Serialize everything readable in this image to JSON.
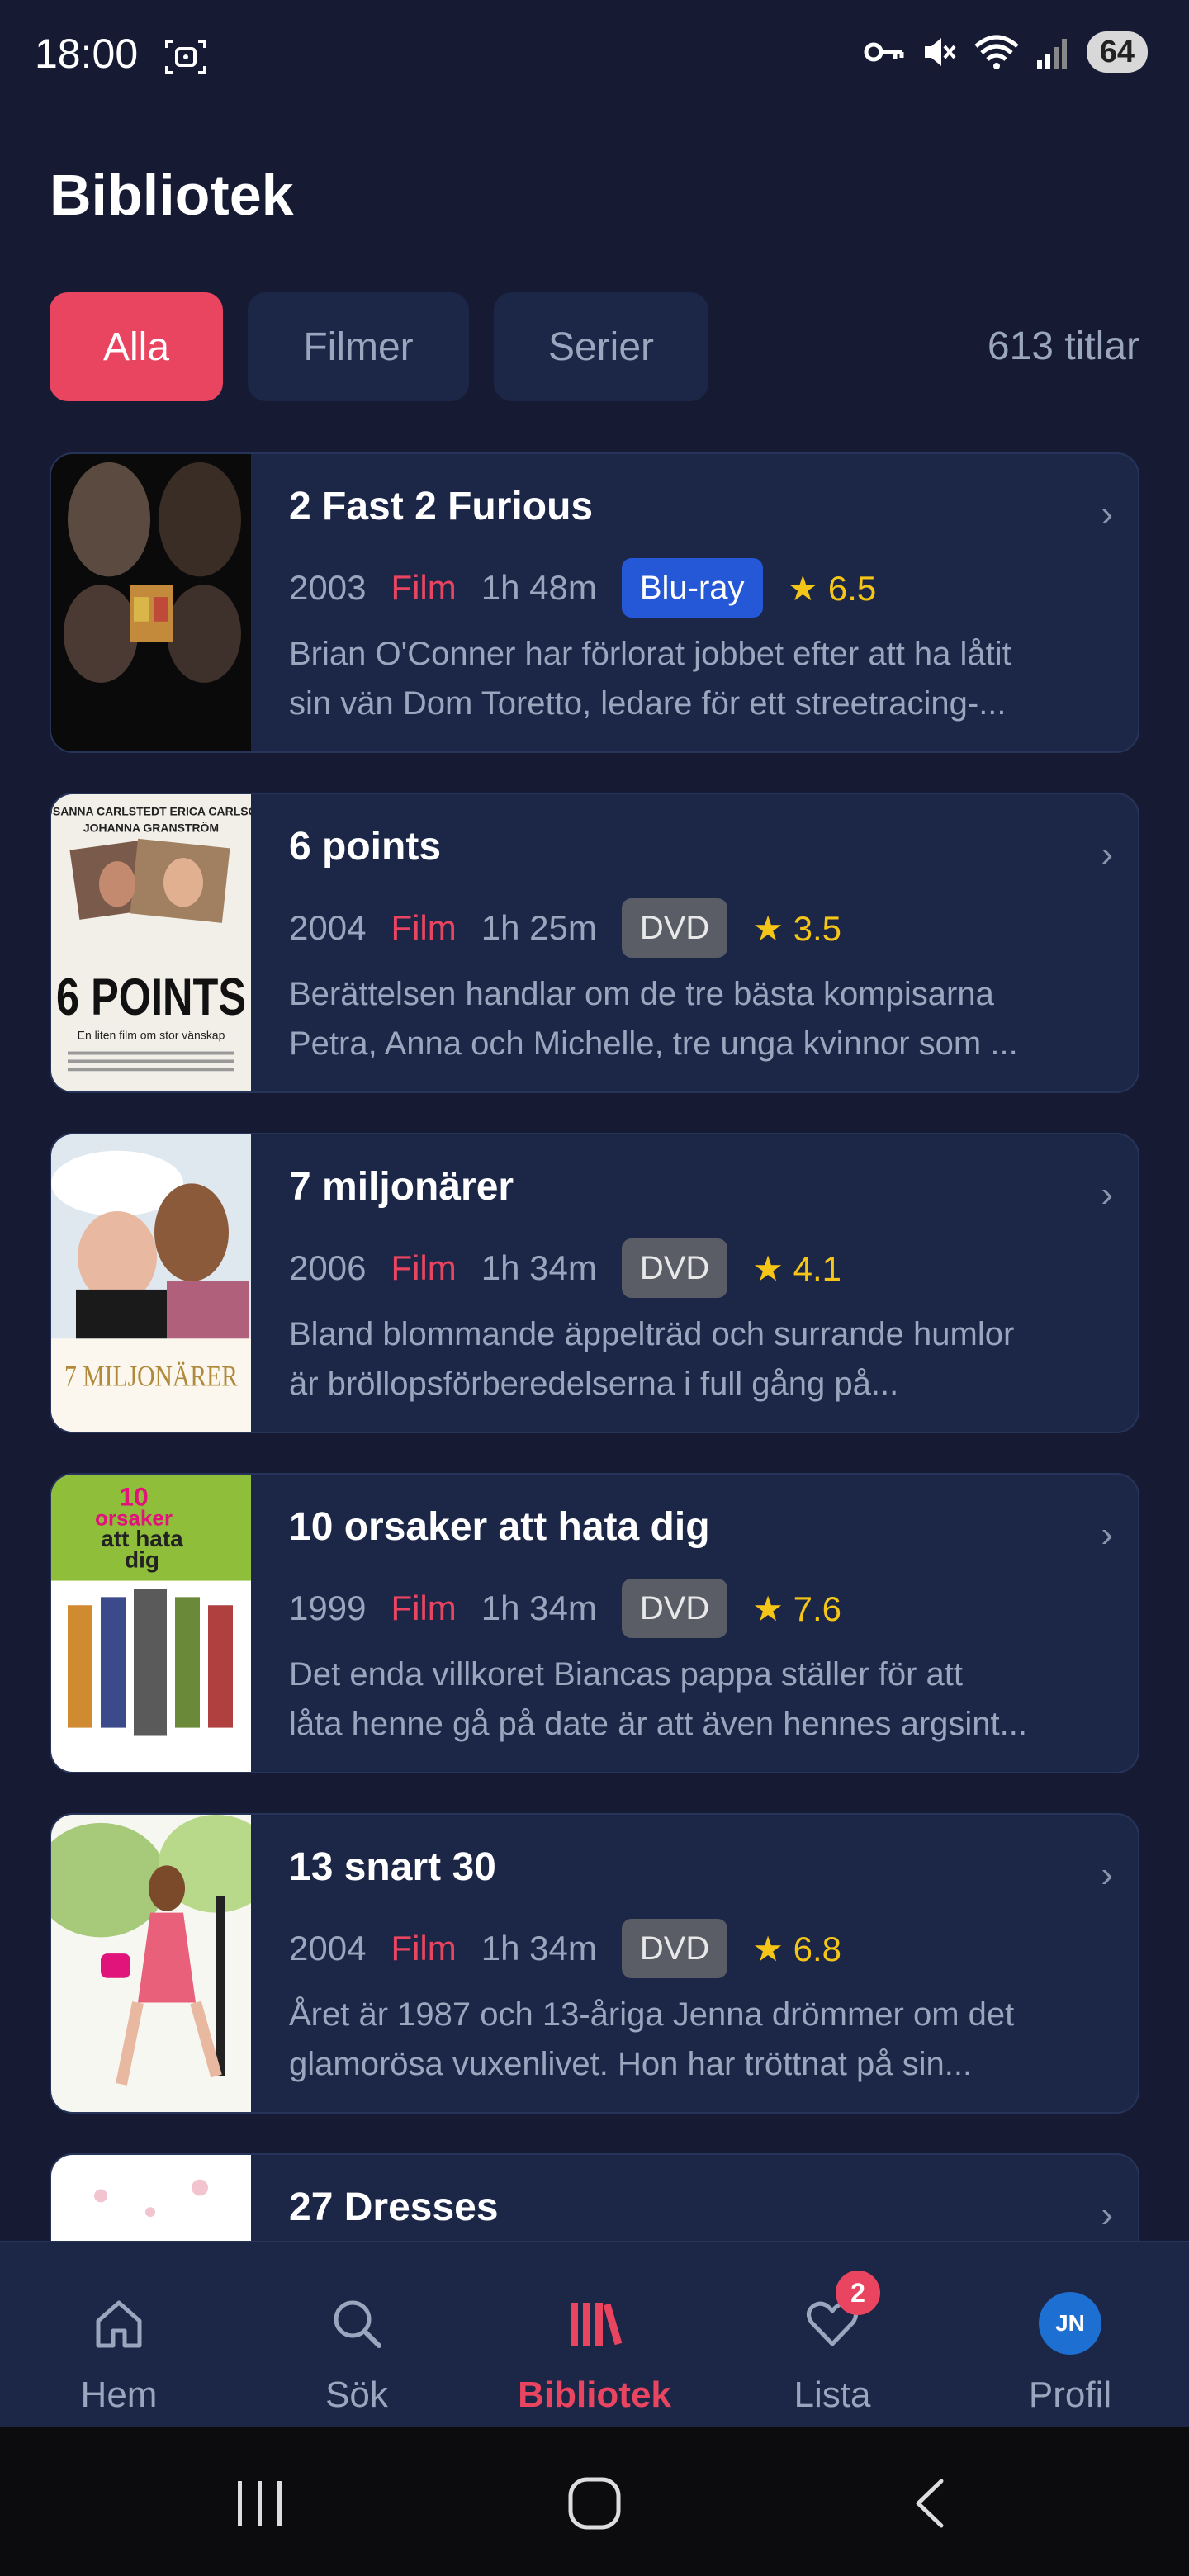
{
  "status_bar": {
    "time": "18:00",
    "battery": "64",
    "icons": [
      "screenshot-icon",
      "key-icon",
      "mute-icon",
      "wifi-icon",
      "signal-icon",
      "battery-icon"
    ]
  },
  "header": {
    "title": "Bibliotek"
  },
  "filters": {
    "chips": [
      "Alla",
      "Filmer",
      "Serier"
    ],
    "active": "Alla",
    "count": "613 titlar"
  },
  "colors": {
    "accent": "#e94560",
    "background": "#161b33",
    "card": "#1c2747",
    "bluray": "#2558d6",
    "dvd": "#5a5d66",
    "rating": "#f5c518"
  },
  "items": [
    {
      "title": "2 Fast 2 Furious",
      "year": "2003",
      "type": "Film",
      "length": "1h 48m",
      "format": "Blu-ray",
      "rating": "★ 6.5",
      "desc1": "Brian O'Conner har förlorat jobbet efter att ha låtit",
      "desc2": "sin vän Dom Toretto, ledare för ett streetracing-..."
    },
    {
      "title": "6 points",
      "year": "2004",
      "type": "Film",
      "length": "1h 25m",
      "format": "DVD",
      "rating": "★ 3.5",
      "desc1": "Berättelsen handlar om de tre bästa kompisarna",
      "desc2": "Petra, Anna och Michelle, tre unga kvinnor som ...",
      "poster_text": "6 POINTS",
      "poster_names": "SUSANNA CARLSTEDT   ERICA CARLSON",
      "poster_names2": "JOHANNA GRANSTRÖM",
      "poster_tagline": "En liten film om stor vänskap"
    },
    {
      "title": "7 miljonärer",
      "year": "2006",
      "type": "Film",
      "length": "1h 34m",
      "format": "DVD",
      "rating": "★ 4.1",
      "desc1": "Bland blommande äppelträd och surrande humlor",
      "desc2": "är bröllopsförberedelserna i full gång på...",
      "poster_text": "7 MILJONÄRER"
    },
    {
      "title": "10 orsaker att hata dig",
      "year": "1999",
      "type": "Film",
      "length": "1h 34m",
      "format": "DVD",
      "rating": "★ 7.6",
      "desc1": "Det enda villkoret Biancas pappa ställer för att",
      "desc2": "låta henne gå på date är att även hennes argsint...",
      "poster_l1": "10",
      "poster_l2": "orsaker",
      "poster_l3": "att hata",
      "poster_l4": "dig"
    },
    {
      "title": "13 snart 30",
      "year": "2004",
      "type": "Film",
      "length": "1h 34m",
      "format": "DVD",
      "rating": "★ 6.8",
      "desc1": "Året är 1987 och 13-åriga Jenna drömmer om det",
      "desc2": "glamorösa vuxenlivet. Hon har tröttnat på sin..."
    },
    {
      "title": "27 Dresses"
    }
  ],
  "bottom_nav": {
    "items": [
      "Hem",
      "Sök",
      "Bibliotek",
      "Lista",
      "Profil"
    ],
    "active": "Bibliotek",
    "list_badge": "2",
    "avatar_initials": "JN"
  },
  "system_nav": {
    "icons": [
      "recent-apps-icon",
      "home-icon",
      "back-icon"
    ]
  }
}
